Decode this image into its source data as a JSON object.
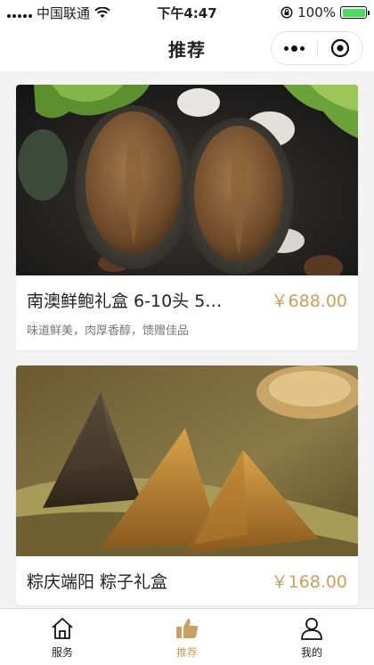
{
  "status_bar": {
    "carrier": "中国联通",
    "time": "下午4:47",
    "battery_pct": "100%",
    "battery_level": 1.0
  },
  "nav": {
    "title": "推荐"
  },
  "colors": {
    "accent_gold": "#c9a063",
    "battery_green": "#4cd964"
  },
  "products": [
    {
      "title": "南澳鲜鲍礼盒 6-10头 5…",
      "price": "￥688.00",
      "desc": "味道鲜美，肉厚香醇，馈赠佳品",
      "image_subject": "abalone"
    },
    {
      "title": "粽庆端阳 粽子礼盒",
      "price": "￥168.00",
      "desc": "",
      "image_subject": "zongzi"
    }
  ],
  "tabs": [
    {
      "label": "服务",
      "icon": "home-icon",
      "active": false
    },
    {
      "label": "推荐",
      "icon": "thumbs-up-icon",
      "active": true
    },
    {
      "label": "我的",
      "icon": "user-icon",
      "active": false
    }
  ]
}
